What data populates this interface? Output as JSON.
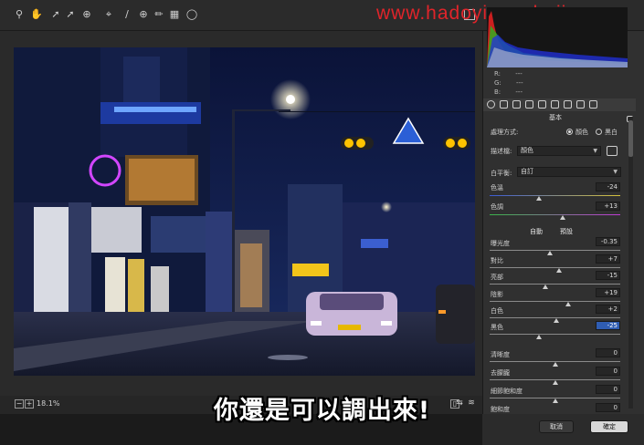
{
  "watermark": "www.hadoyinanshejj.com",
  "toolbar": {
    "tools": [
      "zoom-icon",
      "hand-icon",
      "white-balance-icon",
      "color-sampler-icon",
      "target-adjust-icon",
      "crop-icon",
      "straighten-icon",
      "spot-removal-icon",
      "brush-icon",
      "graduated-filter-icon",
      "radial-filter-icon"
    ]
  },
  "histogram": {
    "r_label": "R:",
    "r_value": "---",
    "g_label": "G:",
    "g_value": "---",
    "b_label": "B:",
    "b_value": "---"
  },
  "panel": {
    "section_title": "基本",
    "treatment_label": "處理方式:",
    "treatment_color": "顏色",
    "treatment_bw": "黑白",
    "profile_label": "描述檔:",
    "profile_value": "顏色",
    "wb_label": "白平衡:",
    "wb_value": "自訂",
    "auto_label": "自動",
    "default_label": "預設"
  },
  "sliders": [
    {
      "label": "色溫",
      "value": "-24",
      "level": 0.38
    },
    {
      "label": "色調",
      "value": "+13",
      "level": 0.56
    },
    {
      "label": "曝光度",
      "value": "-0.35",
      "level": 0.46
    },
    {
      "label": "對比",
      "value": "+7",
      "level": 0.53
    },
    {
      "label": "亮部",
      "value": "-15",
      "level": 0.43
    },
    {
      "label": "陰影",
      "value": "+19",
      "level": 0.6
    },
    {
      "label": "白色",
      "value": "+2",
      "level": 0.51
    },
    {
      "label": "黑色",
      "value": "-25",
      "level": 0.38
    },
    {
      "label": "清晰度",
      "value": "0",
      "level": 0.5
    },
    {
      "label": "去朦朧",
      "value": "0",
      "level": 0.5
    },
    {
      "label": "細節飽和度",
      "value": "0",
      "level": 0.5
    },
    {
      "label": "飽和度",
      "value": "0",
      "level": 0.5
    }
  ],
  "zoom": "18.1%",
  "subtitle": "你還是可以調出來!",
  "buttons": {
    "cancel": "取消",
    "ok": "確定"
  }
}
